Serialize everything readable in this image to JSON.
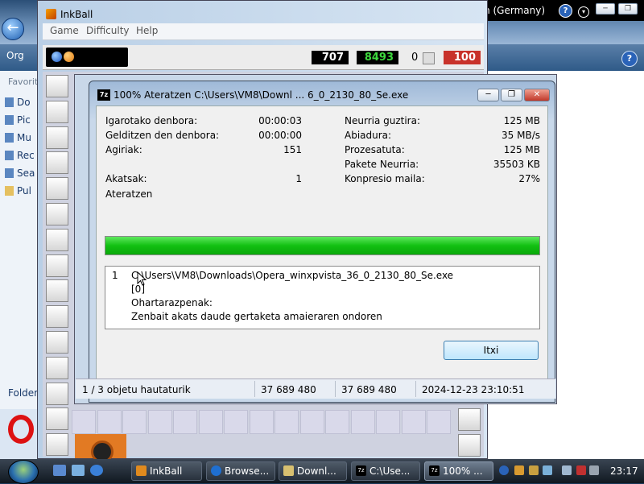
{
  "explorer": {
    "organize_label": "Org",
    "favorites_label": "Favorit",
    "fav_items": [
      "Do",
      "Pic",
      "Mu",
      "Rec",
      "Sea",
      "Pul"
    ],
    "folders_label": "Folders"
  },
  "langbar": {
    "language": "DE German (Germany)",
    "help": "?"
  },
  "inkball": {
    "title": "InkBall",
    "menu": [
      "Game",
      "Difficulty",
      "Help"
    ],
    "scores": {
      "left": "707",
      "middle": "8493",
      "count": "0",
      "right": "100"
    },
    "colors": {
      "score_left": "#000000",
      "score_middle": "#000000",
      "score_right": "#c8322a",
      "text_middle": "#3dd83d"
    }
  },
  "dialog": {
    "title": "100% Ateratzen C:\\Users\\VM8\\Downl ... 6_0_2130_80_Se.exe",
    "icon_label": "7z",
    "stats_left": [
      {
        "label": "Igarotako denbora:",
        "value": "00:00:03"
      },
      {
        "label": "Gelditzen den denbora:",
        "value": "00:00:00"
      },
      {
        "label": "Agiriak:",
        "value": "151"
      },
      {
        "label": "Akatsak:",
        "value": "1"
      }
    ],
    "stats_right": [
      {
        "label": "Neurria guztira:",
        "value": "125 MB"
      },
      {
        "label": "Abiadura:",
        "value": "35 MB/s"
      },
      {
        "label": "Prozesatuta:",
        "value": "125 MB"
      },
      {
        "label": "Pakete Neurria:",
        "value": "35503 KB"
      },
      {
        "label": "Konpresio maila:",
        "value": "27%"
      }
    ],
    "status": "Ateratzen",
    "progress": 1.0,
    "log": {
      "index": "1",
      "path": "C:\\Users\\VM8\\Downloads\\Opera_winxpvista_36_0_2130_80_Se.exe",
      "code": "[0]",
      "warnings_label": "Ohartarazpenak:",
      "message": "Zenbait akats daude gertaketa amaieraren ondoren"
    },
    "close_button": "Itxi"
  },
  "statusrow": {
    "selection": "1 / 3 objetu hautaturik",
    "size1": "37 689 480",
    "size2": "37 689 480",
    "date": "2024-12-23 23:10:51"
  },
  "taskbar": {
    "tasks": [
      {
        "label": "InkBall",
        "color": "#e08a1e"
      },
      {
        "label": "Browse...",
        "color": "#1f6fd0"
      },
      {
        "label": "Downl...",
        "color": "#d8c070"
      },
      {
        "label": "C:\\Use...",
        "color": "#000000"
      },
      {
        "label": "100% ...",
        "color": "#000000"
      }
    ],
    "time": "23:17"
  }
}
